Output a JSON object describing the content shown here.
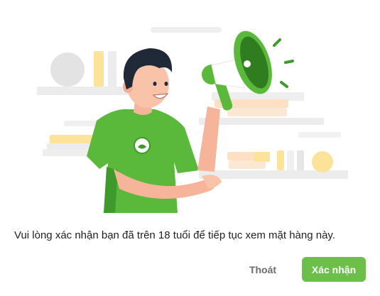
{
  "dialog": {
    "message": "Vui lòng xác nhận bạn đã trên 18 tuổi để tiếp tục xem mặt hàng này.",
    "cancel_label": "Thoát",
    "confirm_label": "Xác nhận"
  },
  "illustration": {
    "name": "man-with-megaphone-illustration"
  },
  "colors": {
    "accent": "#6cc04a",
    "shirt": "#5ab83a",
    "text": "#1f1f1f",
    "muted_text": "#6b6b6b"
  }
}
